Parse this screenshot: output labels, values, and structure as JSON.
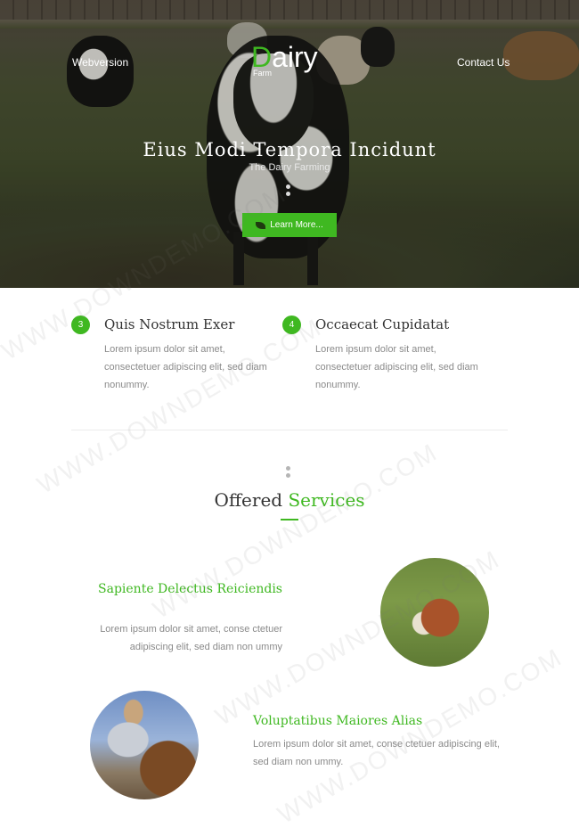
{
  "nav": {
    "left_link": "Webversion",
    "right_link": "Contact Us"
  },
  "logo": {
    "initial": "D",
    "rest": "airy",
    "sub": "Farm"
  },
  "hero": {
    "title": "Eius Modi Tempora Incidunt",
    "subtitle": "The Dairy Farming",
    "button_label": "Learn More..."
  },
  "features": [
    {
      "number": "3",
      "title": "Quis Nostrum Exer",
      "text": "Lorem ipsum dolor sit amet, consectetuer adipiscing elit, sed diam nonummy."
    },
    {
      "number": "4",
      "title": "Occaecat Cupidatat",
      "text": "Lorem ipsum dolor sit amet, consectetuer adipiscing elit, sed diam nonummy."
    }
  ],
  "services": {
    "title_plain": "Offered ",
    "title_accent": "Services",
    "items": [
      {
        "title": "Sapiente Delectus Reiciendis",
        "text": "Lorem ipsum dolor sit amet, conse ctetuer adipiscing elit, sed diam non ummy"
      },
      {
        "title": "Voluptatibus Maiores Alias",
        "text": "Lorem ipsum dolor sit amet, conse ctetuer adipiscing elit, sed diam non ummy."
      }
    ]
  },
  "watermark": "WWW.DOWNDEMO.COM",
  "colors": {
    "accent": "#3fb821",
    "heading": "#333333",
    "body_text": "#8a8a8a"
  },
  "icons": {
    "button_icon": "leaf-icon"
  }
}
